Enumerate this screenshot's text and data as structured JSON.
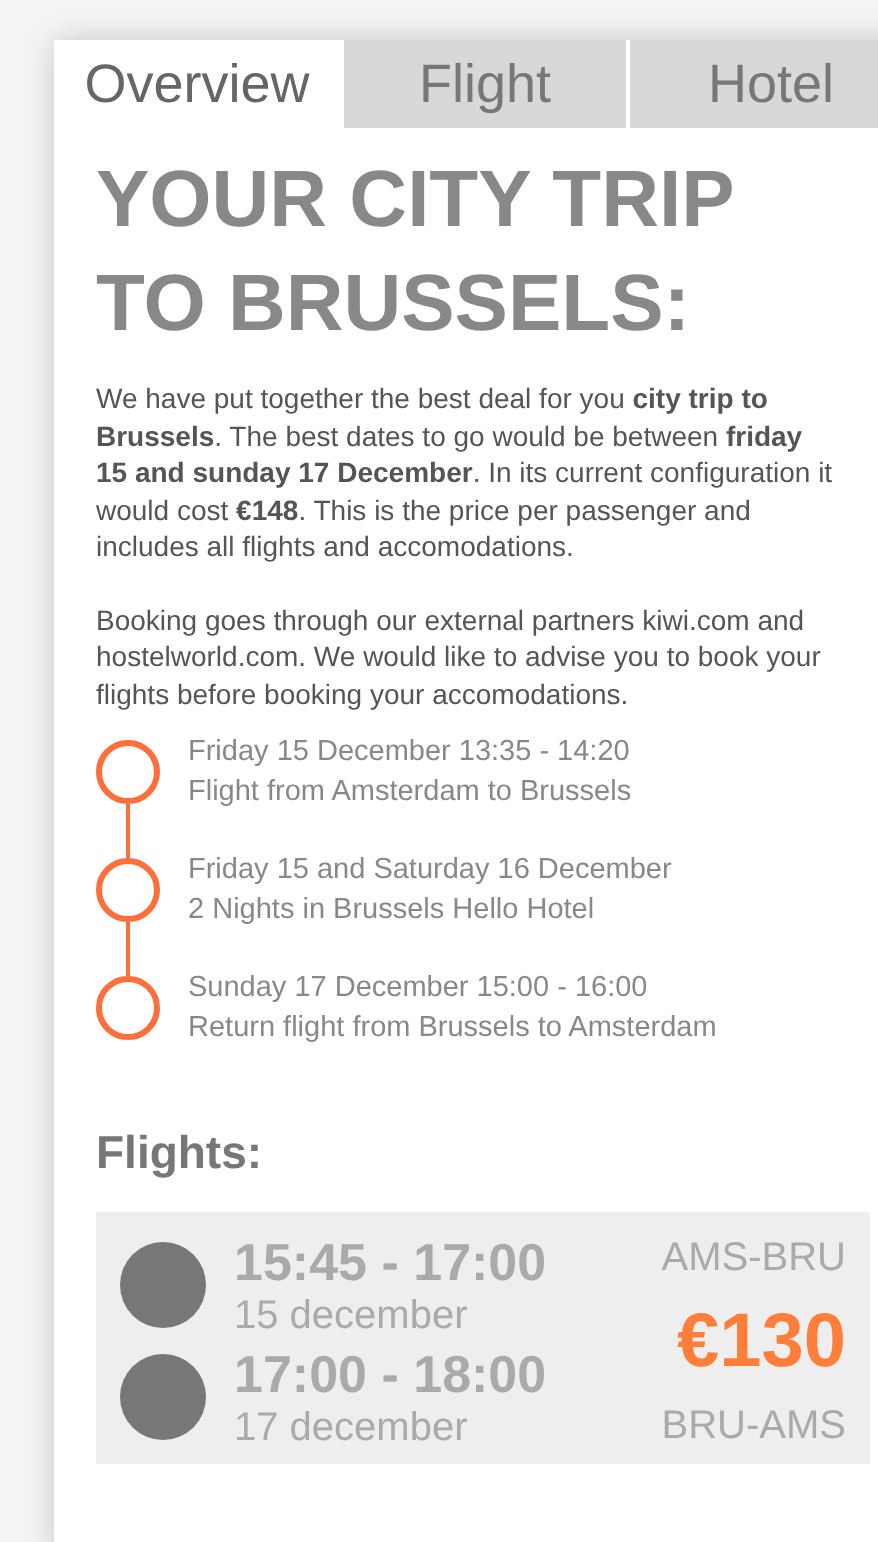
{
  "tabs": [
    {
      "label": "Overview",
      "selected": true
    },
    {
      "label": "Flight",
      "selected": false
    },
    {
      "label": "Hotel",
      "selected": false
    }
  ],
  "title": "YOUR CITY TRIP TO BRUSSELS:",
  "paragraphs": [
    "We have put together the best deal for you **city trip to Brussels**. The best dates to go would be between **friday 15 and sunday 17 December**. In its current configuration it would cost **€148**. This is the price per passenger and includes all flights and accomodations.",
    "Booking goes through our external partners kiwi.com and hostelworld.com. We would like to advise you to book your flights before booking your accomodations."
  ],
  "timeline": [
    {
      "when": "Friday 15 December 13:35 - 14:20",
      "what": "Flight from Amsterdam to Brussels"
    },
    {
      "when": "Friday 15 and Saturday 16 December",
      "what": "2 Nights in Brussels Hello Hotel"
    },
    {
      "when": "Sunday 17 December 15:00 - 16:00",
      "what": "Return flight from Brussels to Amsterdam"
    }
  ],
  "flights_heading": "Flights:",
  "flight_option": {
    "legs": [
      {
        "time": "15:45 - 17:00",
        "date": "15 december",
        "route": "AMS-BRU"
      },
      {
        "time": "17:00 - 18:00",
        "date": "17 december",
        "route": "BRU-AMS"
      }
    ],
    "price": "€130"
  }
}
